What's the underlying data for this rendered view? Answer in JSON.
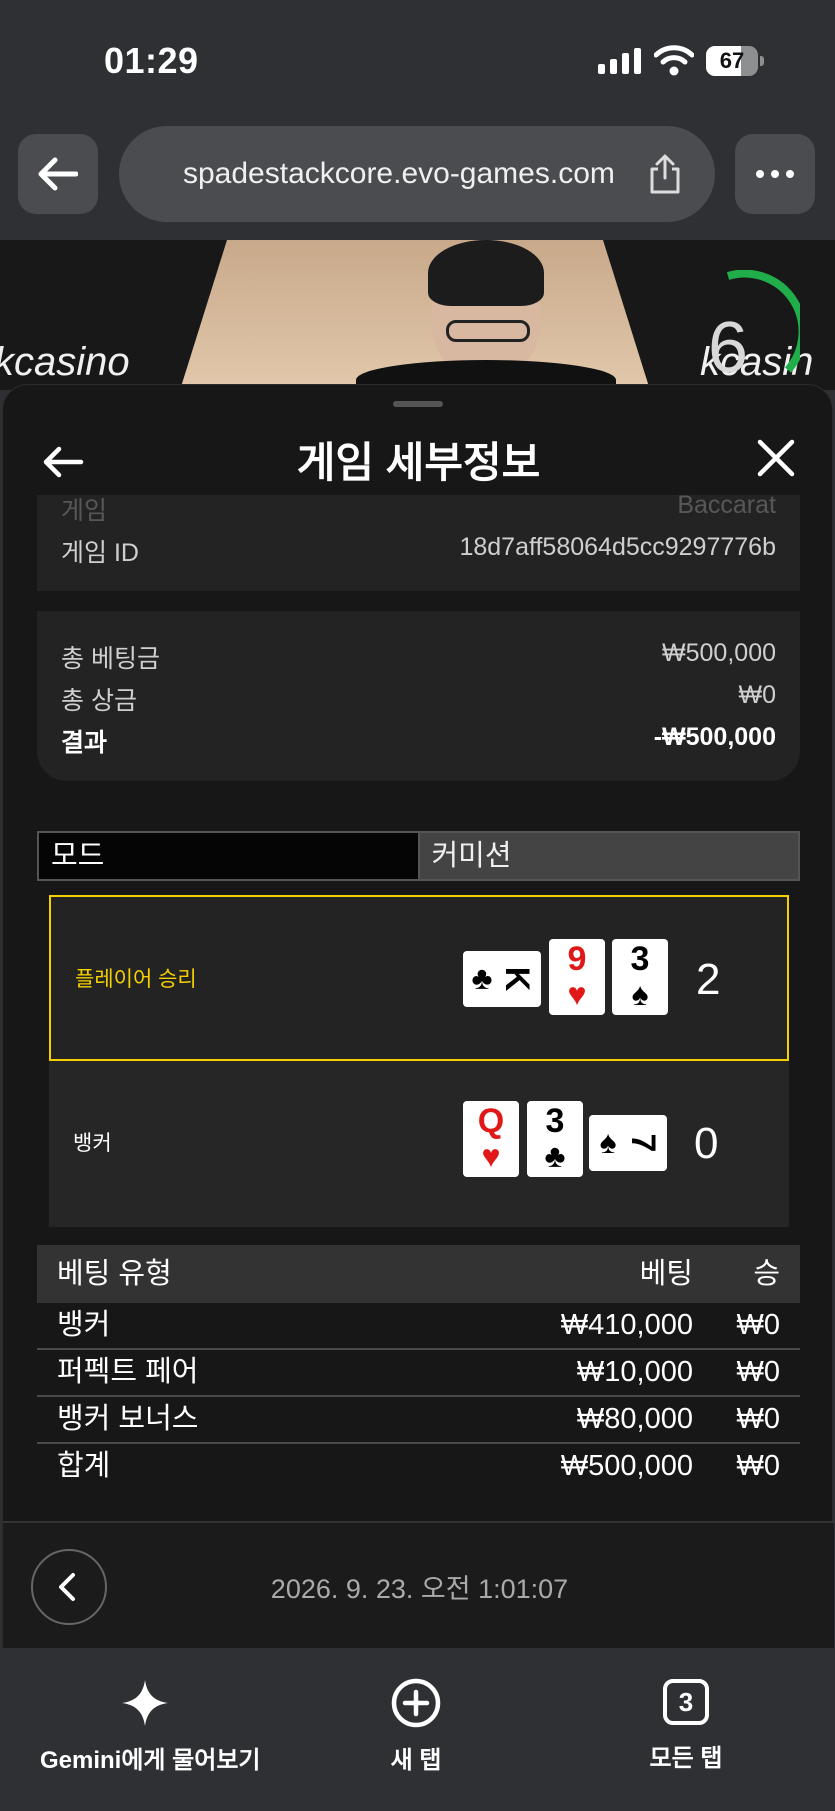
{
  "status_bar": {
    "time": "01:29",
    "battery": "67",
    "battery_level": 0.67
  },
  "browser": {
    "url": "spadestackcore.evo-games.com"
  },
  "video": {
    "logo_left": "kcasino",
    "logo_right": "kcasin",
    "countdown": "6"
  },
  "sheet": {
    "title": "게임 세부정보",
    "game_label": "게임",
    "game_value": "Baccarat",
    "game_id_label": "게임 ID",
    "game_id_value": "18d7aff58064d5cc9297776b",
    "total_bet_label": "총 베팅금",
    "total_bet_value": "₩500,000",
    "total_prize_label": "총 상금",
    "total_prize_value": "₩0",
    "result_label": "결과",
    "result_value": "-₩500,000"
  },
  "tabs": [
    {
      "label": "모드"
    },
    {
      "label": "커미션"
    }
  ],
  "hands": {
    "player": {
      "label": "플레이어 승리",
      "score": "2",
      "cards": [
        {
          "rank": "K",
          "suit": "♣",
          "color": "#000000"
        },
        {
          "rank": "9",
          "suit": "♥",
          "color": "#e01818"
        },
        {
          "rank": "3",
          "suit": "♠",
          "color": "#000000"
        }
      ]
    },
    "banker": {
      "label": "뱅커",
      "score": "0",
      "cards": [
        {
          "rank": "Q",
          "suit": "♥",
          "color": "#e01818"
        },
        {
          "rank": "3",
          "suit": "♣",
          "color": "#000000"
        },
        {
          "rank": "7",
          "suit": "♠",
          "color": "#000000"
        }
      ]
    }
  },
  "bet_table": {
    "headers": {
      "type": "베팅 유형",
      "bet": "베팅",
      "win": "승"
    },
    "rows": [
      {
        "type": "뱅커",
        "bet": "₩410,000",
        "win": "₩0"
      },
      {
        "type": "퍼펙트 페어",
        "bet": "₩10,000",
        "win": "₩0"
      },
      {
        "type": "뱅커 보너스",
        "bet": "₩80,000",
        "win": "₩0"
      }
    ],
    "total": {
      "type": "합계",
      "bet": "₩500,000",
      "win": "₩0"
    }
  },
  "footer": {
    "date": "2026. 9. 23. 오전 1:01:07"
  },
  "bottom_nav": {
    "gemini": "Gemini에게 물어보기",
    "new_tab": "새 탭",
    "all_tabs": "모든 탭",
    "tab_count": "3"
  }
}
